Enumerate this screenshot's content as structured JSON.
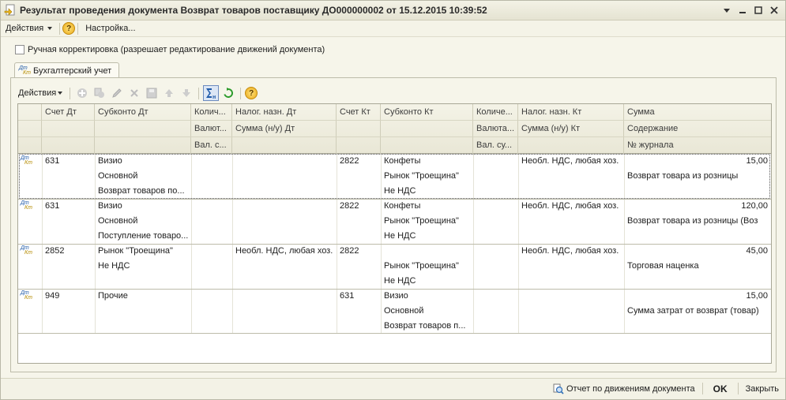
{
  "window": {
    "title": "Результат проведения документа Возврат товаров поставщику ДО000000002 от 15.12.2015 10:39:52"
  },
  "menubar": {
    "actions_label": "Действия",
    "settings_label": "Настройка..."
  },
  "manual_correction": {
    "label": "Ручная корректировка (разрешает редактирование движений документа)",
    "checked": false
  },
  "tab": {
    "label": "Бухгалтерский учет"
  },
  "toolbar": {
    "actions_label": "Действия"
  },
  "grid": {
    "header_row1": [
      "Счет Дт",
      "Субконто Дт",
      "Колич...",
      "Налог. назн. Дт",
      "Счет Кт",
      "Субконто Кт",
      "Количе...",
      "Налог. назн. Кт",
      "Сумма"
    ],
    "header_row2": [
      "Валют...",
      "Сумма (н/у) Дт",
      "Валюта...",
      "Сумма (н/у) Кт",
      "Содержание"
    ],
    "header_row3": [
      "Вал. с...",
      "Вал. су...",
      "№ журнала"
    ],
    "rows": [
      {
        "dt_account": "631",
        "dt_subconto": [
          "Визио",
          "Основной",
          "Возврат товаров по..."
        ],
        "dt_tax": "",
        "kt_account": "2822",
        "kt_subconto": [
          "Конфеты",
          "Рынок \"Троещина\"",
          "Не НДС"
        ],
        "kt_tax": "Необл. НДС, любая хоз.",
        "amount": "15,00",
        "content": "Возврат товара из розницы",
        "journal": ""
      },
      {
        "dt_account": "631",
        "dt_subconto": [
          "Визио",
          "Основной",
          "Поступление товаро..."
        ],
        "dt_tax": "",
        "kt_account": "2822",
        "kt_subconto": [
          "Конфеты",
          "Рынок \"Троещина\"",
          "Не НДС"
        ],
        "kt_tax": "Необл. НДС, любая хоз.",
        "amount": "120,00",
        "content": "Возврат товара из розницы (Воз",
        "journal": ""
      },
      {
        "dt_account": "2852",
        "dt_subconto": [
          "Рынок \"Троещина\"",
          "Не НДС",
          ""
        ],
        "dt_tax": "Необл. НДС, любая хоз.",
        "kt_account": "2822",
        "kt_subconto": [
          "",
          "Рынок \"Троещина\"",
          "Не НДС"
        ],
        "kt_tax": "Необл. НДС, любая хоз.",
        "amount": "45,00",
        "content": "Торговая наценка",
        "journal": ""
      },
      {
        "dt_account": "949",
        "dt_subconto": [
          "Прочие",
          "",
          ""
        ],
        "dt_tax": "",
        "kt_account": "631",
        "kt_subconto": [
          "Визио",
          "Основной",
          "Возврат товаров п..."
        ],
        "kt_tax": "",
        "amount": "15,00",
        "content": "Сумма затрат от возврат (товар)",
        "journal": ""
      }
    ]
  },
  "footer": {
    "report_label": "Отчет по движениям документа",
    "ok_label": "OK",
    "close_label": "Закрыть"
  }
}
